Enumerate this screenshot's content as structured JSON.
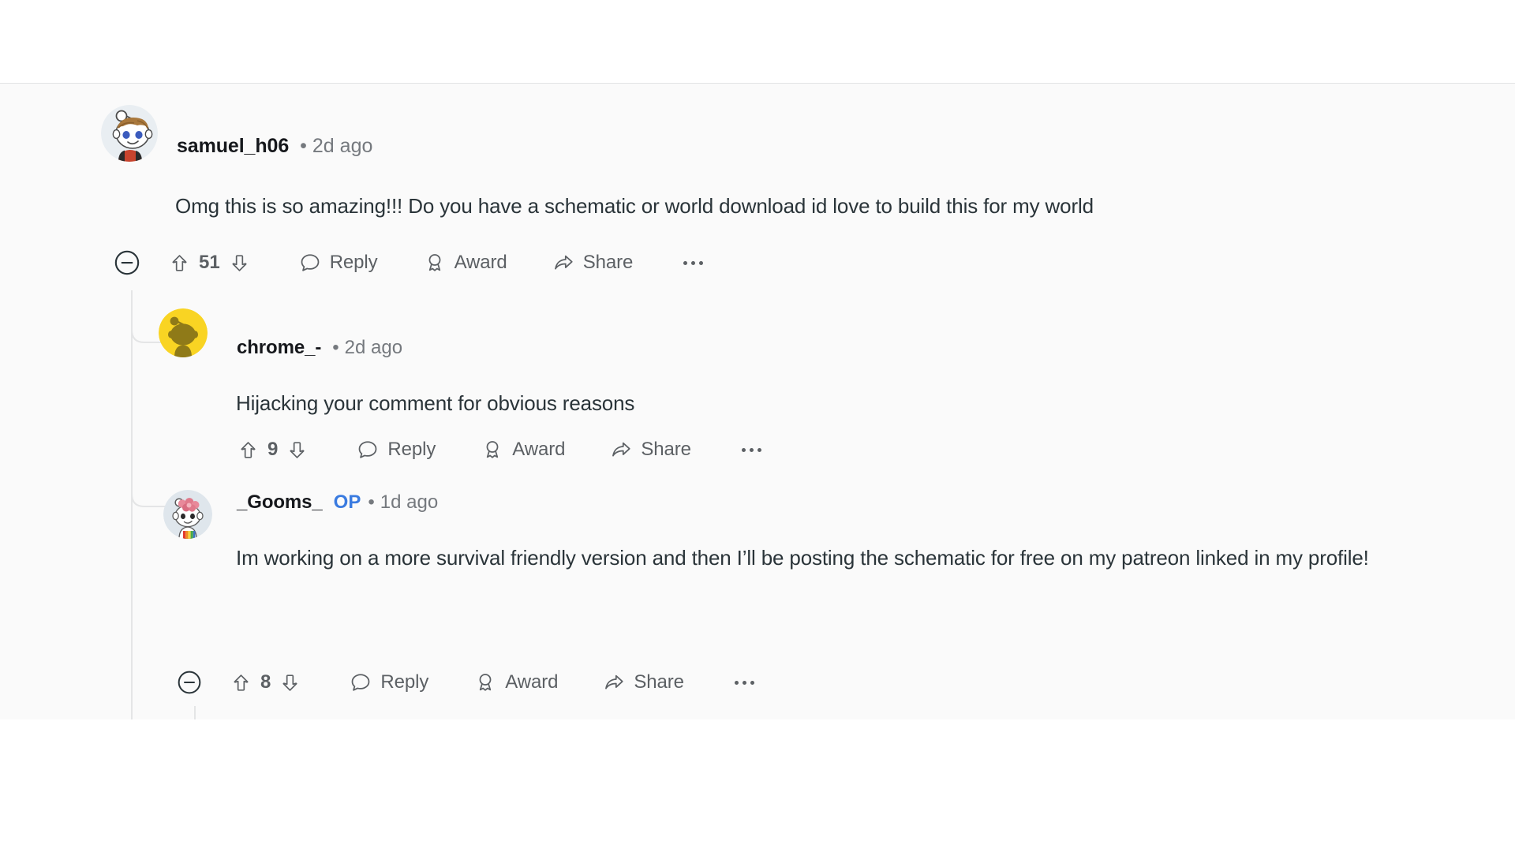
{
  "page": {
    "platform": "reddit-comment-thread",
    "background_color": "#ffffff",
    "content_background_color": "#fafafa",
    "divider_color": "#e2e3e4",
    "thread_line_color": "#e4e5e6",
    "text_color": "#2a3439",
    "author_color": "#16181c",
    "meta_color": "#75797e",
    "action_color": "#5c6064",
    "op_badge_color": "#3a7be0"
  },
  "comments": [
    {
      "id": "comment-1",
      "author": "samuel_h06",
      "is_op": false,
      "op_label": "",
      "separator": "•",
      "timestamp": "2d ago",
      "body": "Omg this is so amazing!!! Do you have a schematic or world download id love to build this for my world",
      "vote_count": "51",
      "has_collapse": true,
      "actions": {
        "upvote": "upvote-icon",
        "downvote": "downvote-icon",
        "reply_label": "Reply",
        "award_label": "Award",
        "share_label": "Share",
        "more_label": "More options"
      },
      "avatar": {
        "name": "avatar-samuel-h06",
        "style": "snoo-brown-hair",
        "background": "#e9eef2",
        "hair_color": "#a9783c",
        "eye_color": "#3b5bbd",
        "shirt_color": "#c8442e"
      }
    },
    {
      "id": "comment-2",
      "author": "chrome_-",
      "is_op": false,
      "op_label": "",
      "separator": "•",
      "timestamp": "2d ago",
      "body": "Hijacking your comment for obvious reasons",
      "vote_count": "9",
      "has_collapse": false,
      "actions": {
        "upvote": "upvote-icon",
        "downvote": "downvote-icon",
        "reply_label": "Reply",
        "award_label": "Award",
        "share_label": "Share",
        "more_label": "More options"
      },
      "avatar": {
        "name": "avatar-chrome",
        "style": "snoo-yellow-silhouette",
        "background": "#f9d423",
        "figure_color": "#8f7a18"
      }
    },
    {
      "id": "comment-3",
      "author": "_Gooms_",
      "is_op": true,
      "op_label": "OP",
      "separator": "•",
      "timestamp": "1d ago",
      "body": "Im working on a more survival friendly version and then I’ll be posting the schematic for free on my patreon linked in my profile!",
      "vote_count": "8",
      "has_collapse": true,
      "actions": {
        "upvote": "upvote-icon",
        "downvote": "downvote-icon",
        "reply_label": "Reply",
        "award_label": "Award",
        "share_label": "Share",
        "more_label": "More options"
      },
      "avatar": {
        "name": "avatar-gooms",
        "style": "snoo-flower-rainbow",
        "background": "#dfe6ec",
        "flower_color": "#e8899a",
        "shirt_colors": [
          "#e23b2e",
          "#f08a24",
          "#f2d23c",
          "#49a94a",
          "#3b74c4"
        ]
      }
    }
  ]
}
